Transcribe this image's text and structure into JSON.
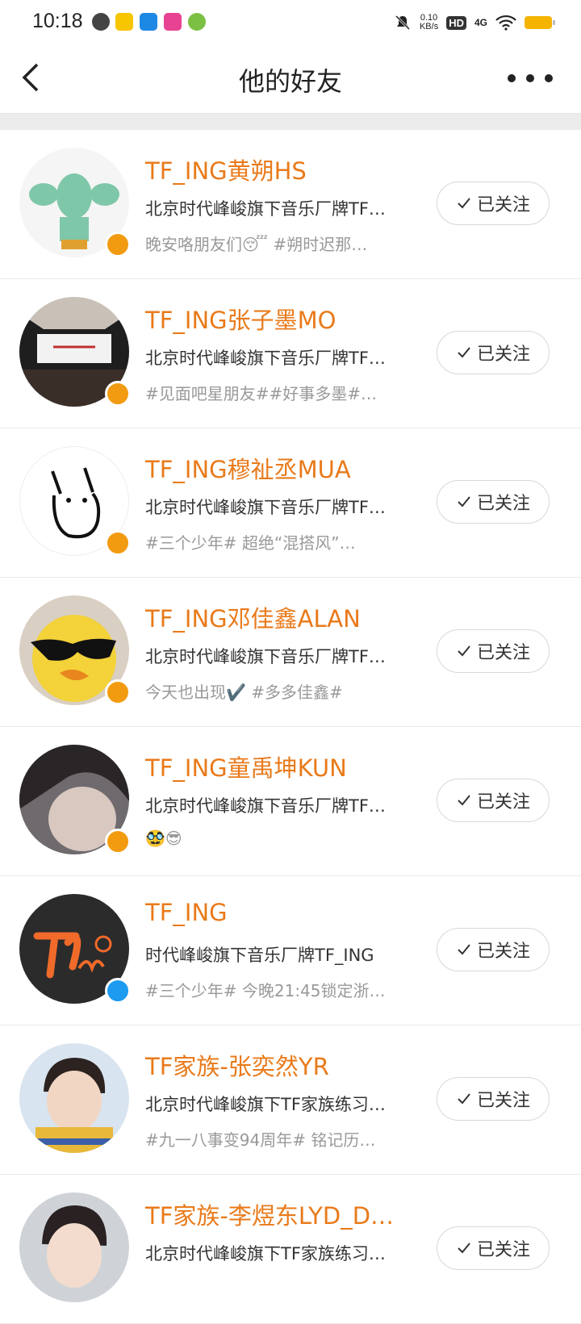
{
  "status_bar": {
    "time": "10:18",
    "speed_value": "0.10",
    "speed_unit": "KB/s",
    "hd": "HD",
    "network": "4G"
  },
  "header": {
    "title": "他的好友",
    "back_icon": "chevron-left-icon",
    "more_icon": "more-dots-icon"
  },
  "colors": {
    "accent": "#e97a1a",
    "verified_orange": "#f29b11",
    "verified_blue": "#1d9bf0"
  },
  "friends": [
    {
      "name": "TF_ING黄朔HS",
      "desc": "北京时代峰峻旗下音乐厂牌TF…",
      "status": "晚安咯朋友们😴 #朔时迟那…",
      "follow_label": "已关注",
      "badge": "orange"
    },
    {
      "name": "TF_ING张子墨MO",
      "desc": "北京时代峰峻旗下音乐厂牌TF…",
      "status": "#见面吧星朋友##好事多墨#…",
      "follow_label": "已关注",
      "badge": "orange"
    },
    {
      "name": "TF_ING穆祉丞MUA",
      "desc": "北京时代峰峻旗下音乐厂牌TF…",
      "status": "#三个少年# 超绝“混搭风”…",
      "follow_label": "已关注",
      "badge": "orange"
    },
    {
      "name": "TF_ING邓佳鑫ALAN",
      "desc": "北京时代峰峻旗下音乐厂牌TF…",
      "status": "今天也出现✔️ #多多佳鑫#",
      "follow_label": "已关注",
      "badge": "orange"
    },
    {
      "name": "TF_ING童禹坤KUN",
      "desc": "北京时代峰峻旗下音乐厂牌TF…",
      "status": "🥸😎",
      "follow_label": "已关注",
      "badge": "orange"
    },
    {
      "name": "TF_ING",
      "desc": "时代峰峻旗下音乐厂牌TF_ING",
      "status": "#三个少年# 今晚21:45锁定浙…",
      "follow_label": "已关注",
      "badge": "blue"
    },
    {
      "name": "TF家族-张奕然YR",
      "desc": "北京时代峰峻旗下TF家族练习…",
      "status": "#九一八事变94周年# 铭记历…",
      "follow_label": "已关注",
      "badge": "none"
    },
    {
      "name": "TF家族-李煜东LYD_D…",
      "desc": "北京时代峰峻旗下TF家族练习…",
      "status": "",
      "follow_label": "已关注",
      "badge": "none"
    }
  ]
}
